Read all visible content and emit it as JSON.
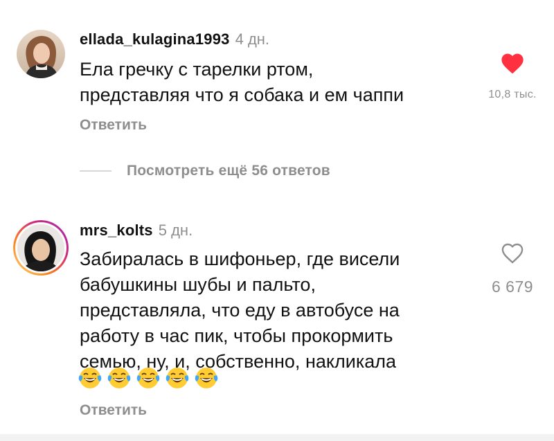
{
  "comments": [
    {
      "username": "ellada_kulagina1993",
      "time": "4 дн.",
      "text": "Ела гречку с тарелки ртом,\nпредставляя что я собака и ем чаппи",
      "like_count": "10,8 тыс.",
      "liked": true,
      "reply_label": "Ответить"
    },
    {
      "username": "mrs_kolts",
      "time": "5 дн.",
      "text": "Забиралась в шифоньер, где висели\nбабушкины шубы и пальто,\nпредставляла, что еду в автобусе на\nработу в час пик, чтобы прокормить\nсемью,  ну, и, собственно, накликала",
      "emoji": [
        "face-with-tears-of-joy",
        "face-with-tears-of-joy",
        "face-with-tears-of-joy",
        "face-with-tears-of-joy",
        "face-with-tears-of-joy"
      ],
      "like_count": "6 679",
      "liked": false,
      "reply_label": "Ответить",
      "has_story_ring": true
    }
  ],
  "view_replies_label": "Посмотреть ещё 56 ответов",
  "colors": {
    "like_red": "#ff3040",
    "secondary_text": "#8e8e8e",
    "primary_text": "#111111",
    "story_ring_start": "#feda75",
    "story_ring_mid": "#d62976",
    "story_ring_end": "#962fbf"
  }
}
